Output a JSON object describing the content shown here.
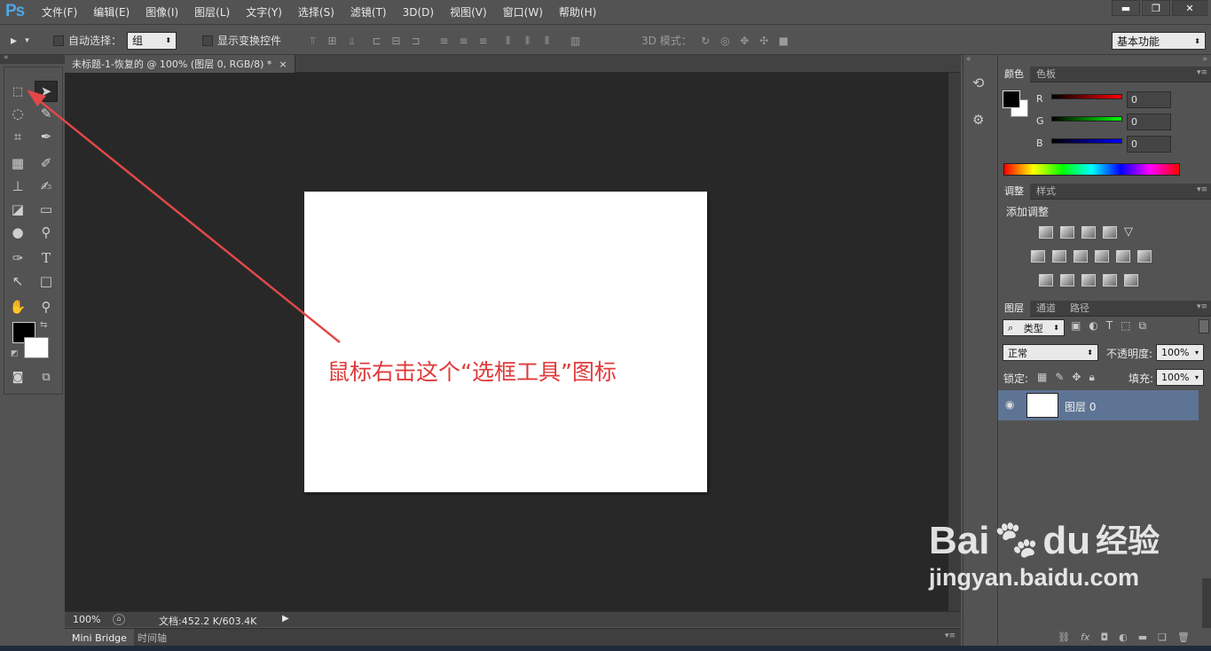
{
  "app": {
    "logo": "Ps"
  },
  "menus": [
    "文件(F)",
    "编辑(E)",
    "图像(I)",
    "图层(L)",
    "文字(Y)",
    "选择(S)",
    "滤镜(T)",
    "3D(D)",
    "视图(V)",
    "窗口(W)",
    "帮助(H)"
  ],
  "window_controls": {
    "minimize": "▬",
    "restore": "❐",
    "close": "✕"
  },
  "options_bar": {
    "auto_select_label": "自动选择：",
    "auto_select_value": "组",
    "show_transform_label": "显示变换控件",
    "mode3d_label": "3D 模式：",
    "workspace_value": "基本功能"
  },
  "document_tab": {
    "title": "未标题-1-恢复的 @ 100% (图层 0, RGB/8) *",
    "close": "×"
  },
  "annotation": "鼠标右击这个“选框工具”图标",
  "status_bar": {
    "zoom": "100%",
    "doc_info": "文档:452.2 K/603.4K"
  },
  "bottom_tabs": [
    "Mini Bridge",
    "时间轴"
  ],
  "color_panel": {
    "tabs": [
      "颜色",
      "色板"
    ],
    "channels": [
      {
        "label": "R",
        "value": "0"
      },
      {
        "label": "G",
        "value": "0"
      },
      {
        "label": "B",
        "value": "0"
      }
    ],
    "fg_color": "#000000",
    "bg_color": "#ffffff"
  },
  "adjust_panel": {
    "tabs": [
      "调整",
      "样式"
    ],
    "title": "添加调整"
  },
  "layers_panel": {
    "tabs": [
      "图层",
      "通道",
      "路径"
    ],
    "filter_kind": "类型",
    "blend_mode": "正常",
    "opacity_label": "不透明度:",
    "opacity_value": "100%",
    "lock_label": "锁定:",
    "fill_label": "填充:",
    "fill_value": "100%",
    "layers": [
      {
        "name": "图层 0",
        "visible": true
      }
    ],
    "footer_icons": [
      "link-icon",
      "fx-icon",
      "mask-icon",
      "adjustment-icon",
      "folder-icon",
      "new-layer-icon",
      "trash-icon"
    ]
  },
  "watermark": {
    "brand": "Bai",
    "brand2": "du",
    "suffix": "经验",
    "url": "jingyan.baidu.com"
  },
  "colors": {
    "accent_annotation": "#e03a3a",
    "ps_blue": "#4aa8e6",
    "selected_layer": "#5e7494"
  }
}
